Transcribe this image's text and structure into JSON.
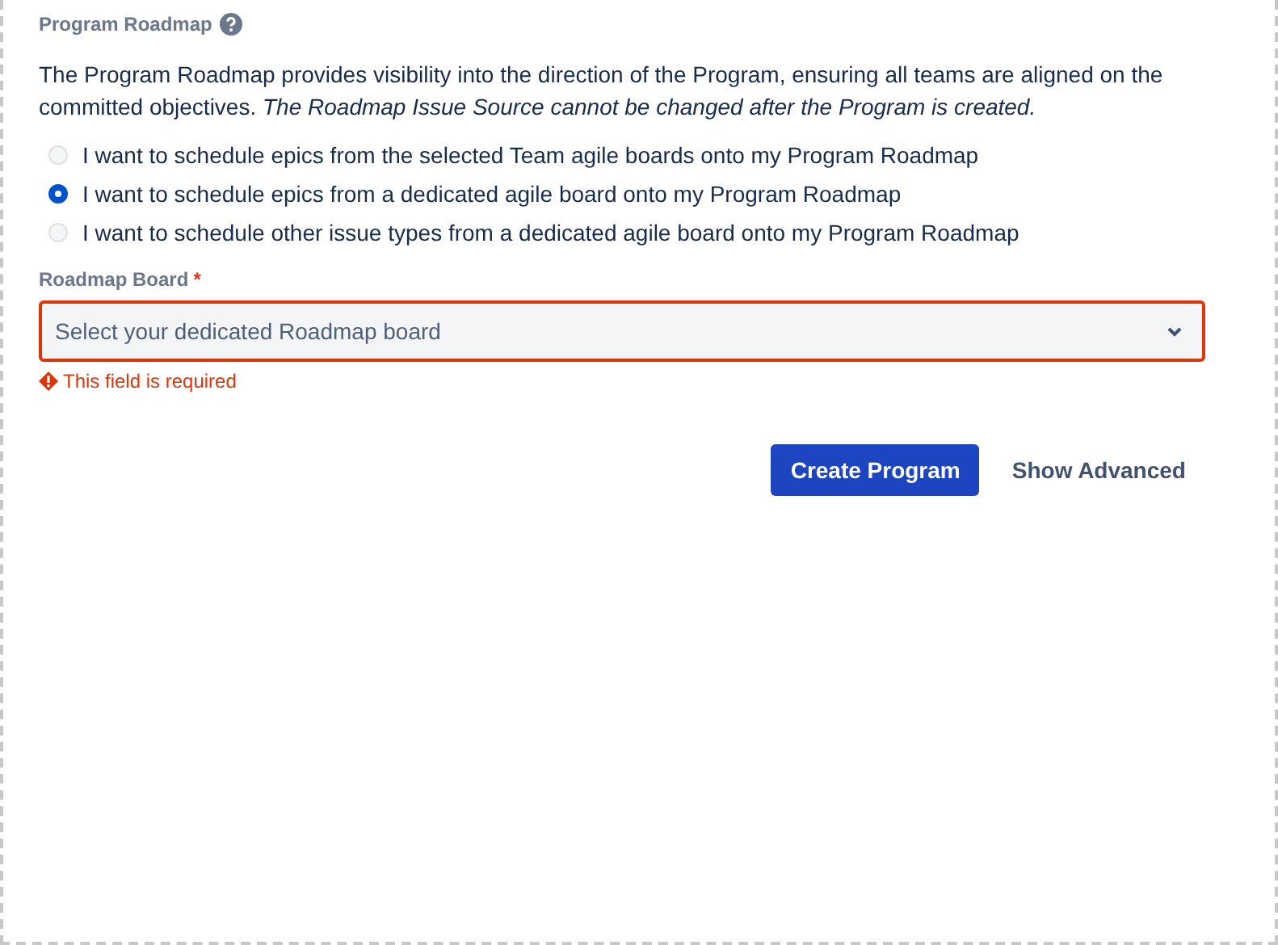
{
  "section": {
    "title": "Program Roadmap",
    "description": "The Program Roadmap provides visibility into the direction of the Program, ensuring all teams are aligned on the committed objectives. *The Roadmap Issue Source cannot be changed after the Program is created.*"
  },
  "options": [
    {
      "label": "I want to schedule epics from the selected Team agile boards onto my Program Roadmap",
      "selected": false
    },
    {
      "label": "I want to schedule epics from a dedicated agile board onto my Program Roadmap",
      "selected": true
    },
    {
      "label": "I want to schedule other issue types from a dedicated agile board onto my Program Roadmap",
      "selected": false
    }
  ],
  "field": {
    "label": "Roadmap Board",
    "required_mark": "*",
    "placeholder": "Select your dedicated Roadmap board",
    "invalid": true,
    "error": "This field is required"
  },
  "buttons": [
    {
      "label": "Create Program",
      "kind": "primary"
    },
    {
      "label": "Show Advanced",
      "kind": "subtle"
    }
  ]
}
